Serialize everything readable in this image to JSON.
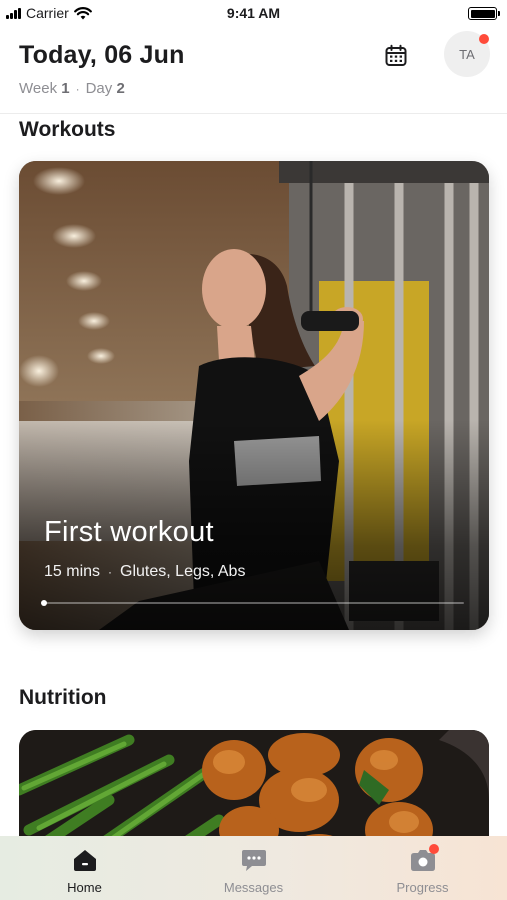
{
  "status_bar": {
    "carrier": "Carrier",
    "time": "9:41 AM"
  },
  "header": {
    "title": "Today, 06 Jun",
    "week_label": "Week",
    "week_value": "1",
    "day_label": "Day",
    "day_value": "2",
    "separator": "·",
    "avatar_initials": "TA",
    "calendar_icon": "calendar-icon"
  },
  "workouts": {
    "section_title": "Workouts",
    "card": {
      "title": "First workout",
      "duration": "15 mins",
      "separator": "·",
      "muscles": "Glutes, Legs, Abs",
      "progress": 0.0
    }
  },
  "nutrition": {
    "section_title": "Nutrition"
  },
  "tab_bar": {
    "tabs": [
      {
        "label": "Home",
        "icon": "home-icon",
        "active": true
      },
      {
        "label": "Messages",
        "icon": "chat-bubble-icon",
        "active": false
      },
      {
        "label": "Progress",
        "icon": "camera-icon",
        "active": false,
        "badge": true
      }
    ]
  },
  "colors": {
    "badge": "#ff4b3a",
    "text_primary": "#1c1c1e",
    "text_secondary": "#8e8e93"
  }
}
